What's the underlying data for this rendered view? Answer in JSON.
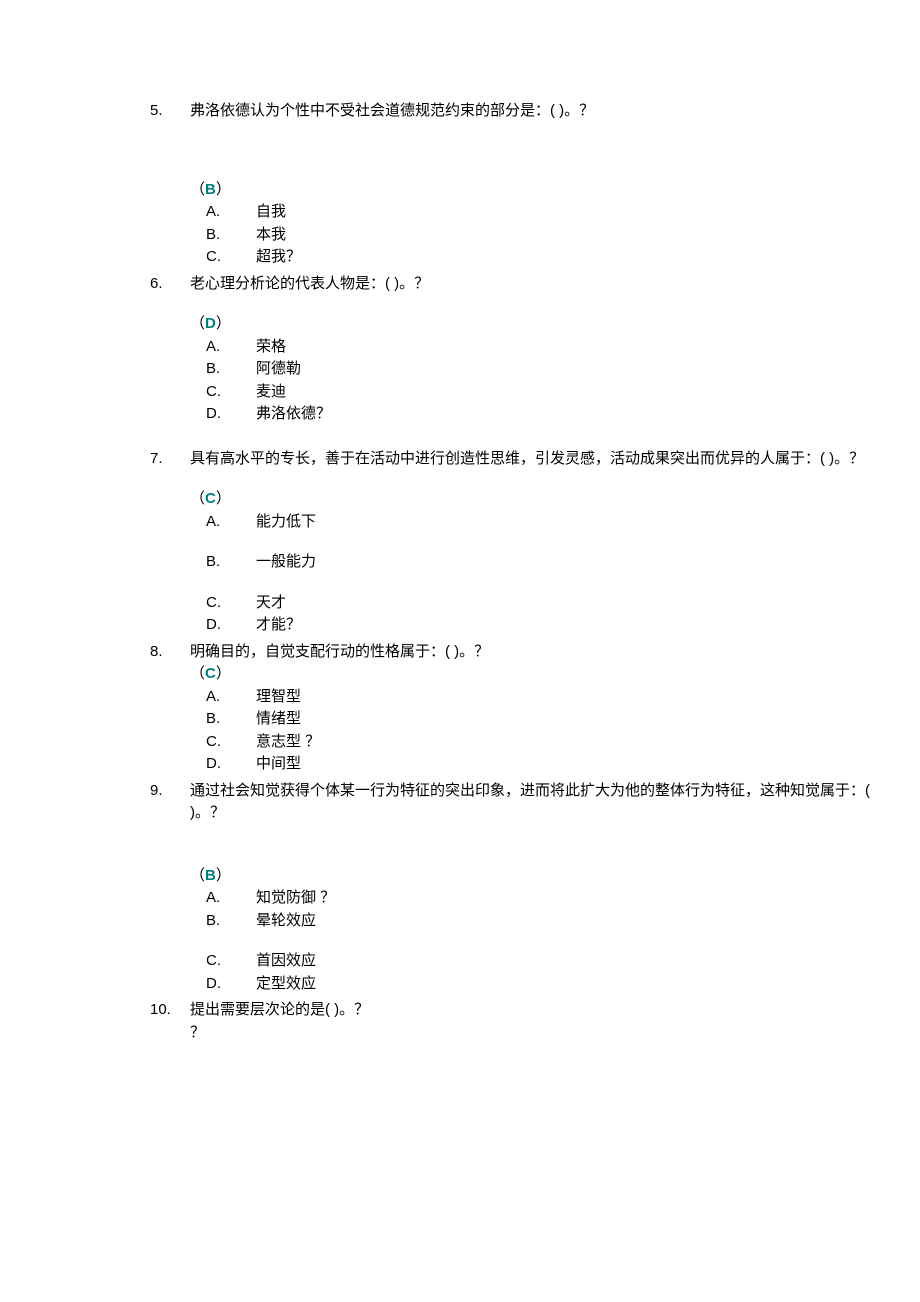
{
  "questions": [
    {
      "num": "5.",
      "text": "弗洛依德认为个性中不受社会道德规范约束的部分是：( )。？",
      "answer": "B",
      "options": [
        {
          "letter": "A.",
          "text": "自我"
        },
        {
          "letter": "B.",
          "text": "本我"
        },
        {
          "letter": "C.",
          "text": "超我？"
        }
      ]
    },
    {
      "num": "6.",
      "text": "老心理分析论的代表人物是：( )。？",
      "answer": "D",
      "options": [
        {
          "letter": "A.",
          "text": "荣格"
        },
        {
          "letter": "B.",
          "text": "阿德勒"
        },
        {
          "letter": "C.",
          "text": "麦迪"
        },
        {
          "letter": "D.",
          "text": "弗洛依德？"
        }
      ]
    },
    {
      "num": "7.",
      "text": "具有高水平的专长，善于在活动中进行创造性思维，引发灵感，活动成果突出而优异的人属于：( )。？",
      "answer": "C",
      "options": [
        {
          "letter": "A.",
          "text": "能力低下"
        },
        {
          "letter": "B.",
          "text": "一般能力"
        },
        {
          "letter": "C.",
          "text": "天才"
        },
        {
          "letter": "D.",
          "text": "才能？"
        }
      ]
    },
    {
      "num": "8.",
      "text": "明确目的，自觉支配行动的性格属于：( )。？",
      "answer": "C",
      "options": [
        {
          "letter": "A.",
          "text": "理智型"
        },
        {
          "letter": "B.",
          "text": "情绪型"
        },
        {
          "letter": "C.",
          "text": "意志型 ？"
        },
        {
          "letter": "D.",
          "text": "中间型"
        }
      ]
    },
    {
      "num": "9.",
      "text": "通过社会知觉获得个体某一行为特征的突出印象，进而将此扩大为他的整体行为特征，这种知觉属于：( )。？",
      "answer": "B",
      "options": [
        {
          "letter": "A.",
          "text": "知觉防御 ？"
        },
        {
          "letter": "B.",
          "text": "晕轮效应"
        },
        {
          "letter": "C.",
          "text": "首因效应"
        },
        {
          "letter": "D.",
          "text": "定型效应"
        }
      ]
    },
    {
      "num": "10.",
      "text": "提出需要层次论的是( )。？",
      "trailing": "？"
    }
  ]
}
